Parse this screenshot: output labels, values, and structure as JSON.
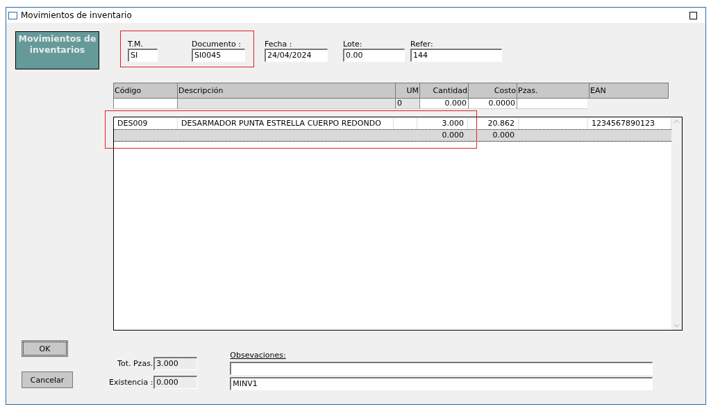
{
  "window": {
    "title": "Movimientos de inventario"
  },
  "banner": "Movimientos de inventarios",
  "header_fields": [
    {
      "label": "T.M.",
      "value": "SI"
    },
    {
      "label": "Documento :",
      "value": "SI0045"
    },
    {
      "label": "Fecha :",
      "value": "24/04/2024"
    },
    {
      "label": "Lote:",
      "value": "0.00"
    },
    {
      "label": "Refer:",
      "value": "144"
    }
  ],
  "grid": {
    "columns": [
      "Código",
      "Descripción",
      "UM",
      "Cantidad",
      "Costo",
      "Pzas.",
      "EAN"
    ],
    "entry": {
      "um": "0",
      "cantidad": "0.000",
      "costo": "0.0000"
    },
    "rows": [
      {
        "selected": false,
        "cells": [
          "DES009",
          "DESARMADOR PUNTA ESTRELLA CUERPO REDONDO",
          null,
          "3.000",
          "20.862",
          null,
          "1234567890123"
        ]
      },
      {
        "selected": true,
        "cells": [
          null,
          null,
          null,
          "0.000",
          "0.000",
          null,
          null
        ]
      }
    ]
  },
  "totals": [
    {
      "label": "Tot. Pzas.",
      "value": "3.000"
    },
    {
      "label": "Existencia :",
      "value": "0.000"
    }
  ],
  "observations": {
    "label": "Obsevaciones:",
    "second_line": "MINV1"
  },
  "buttons": [
    "OK",
    "Cancelar"
  ]
}
